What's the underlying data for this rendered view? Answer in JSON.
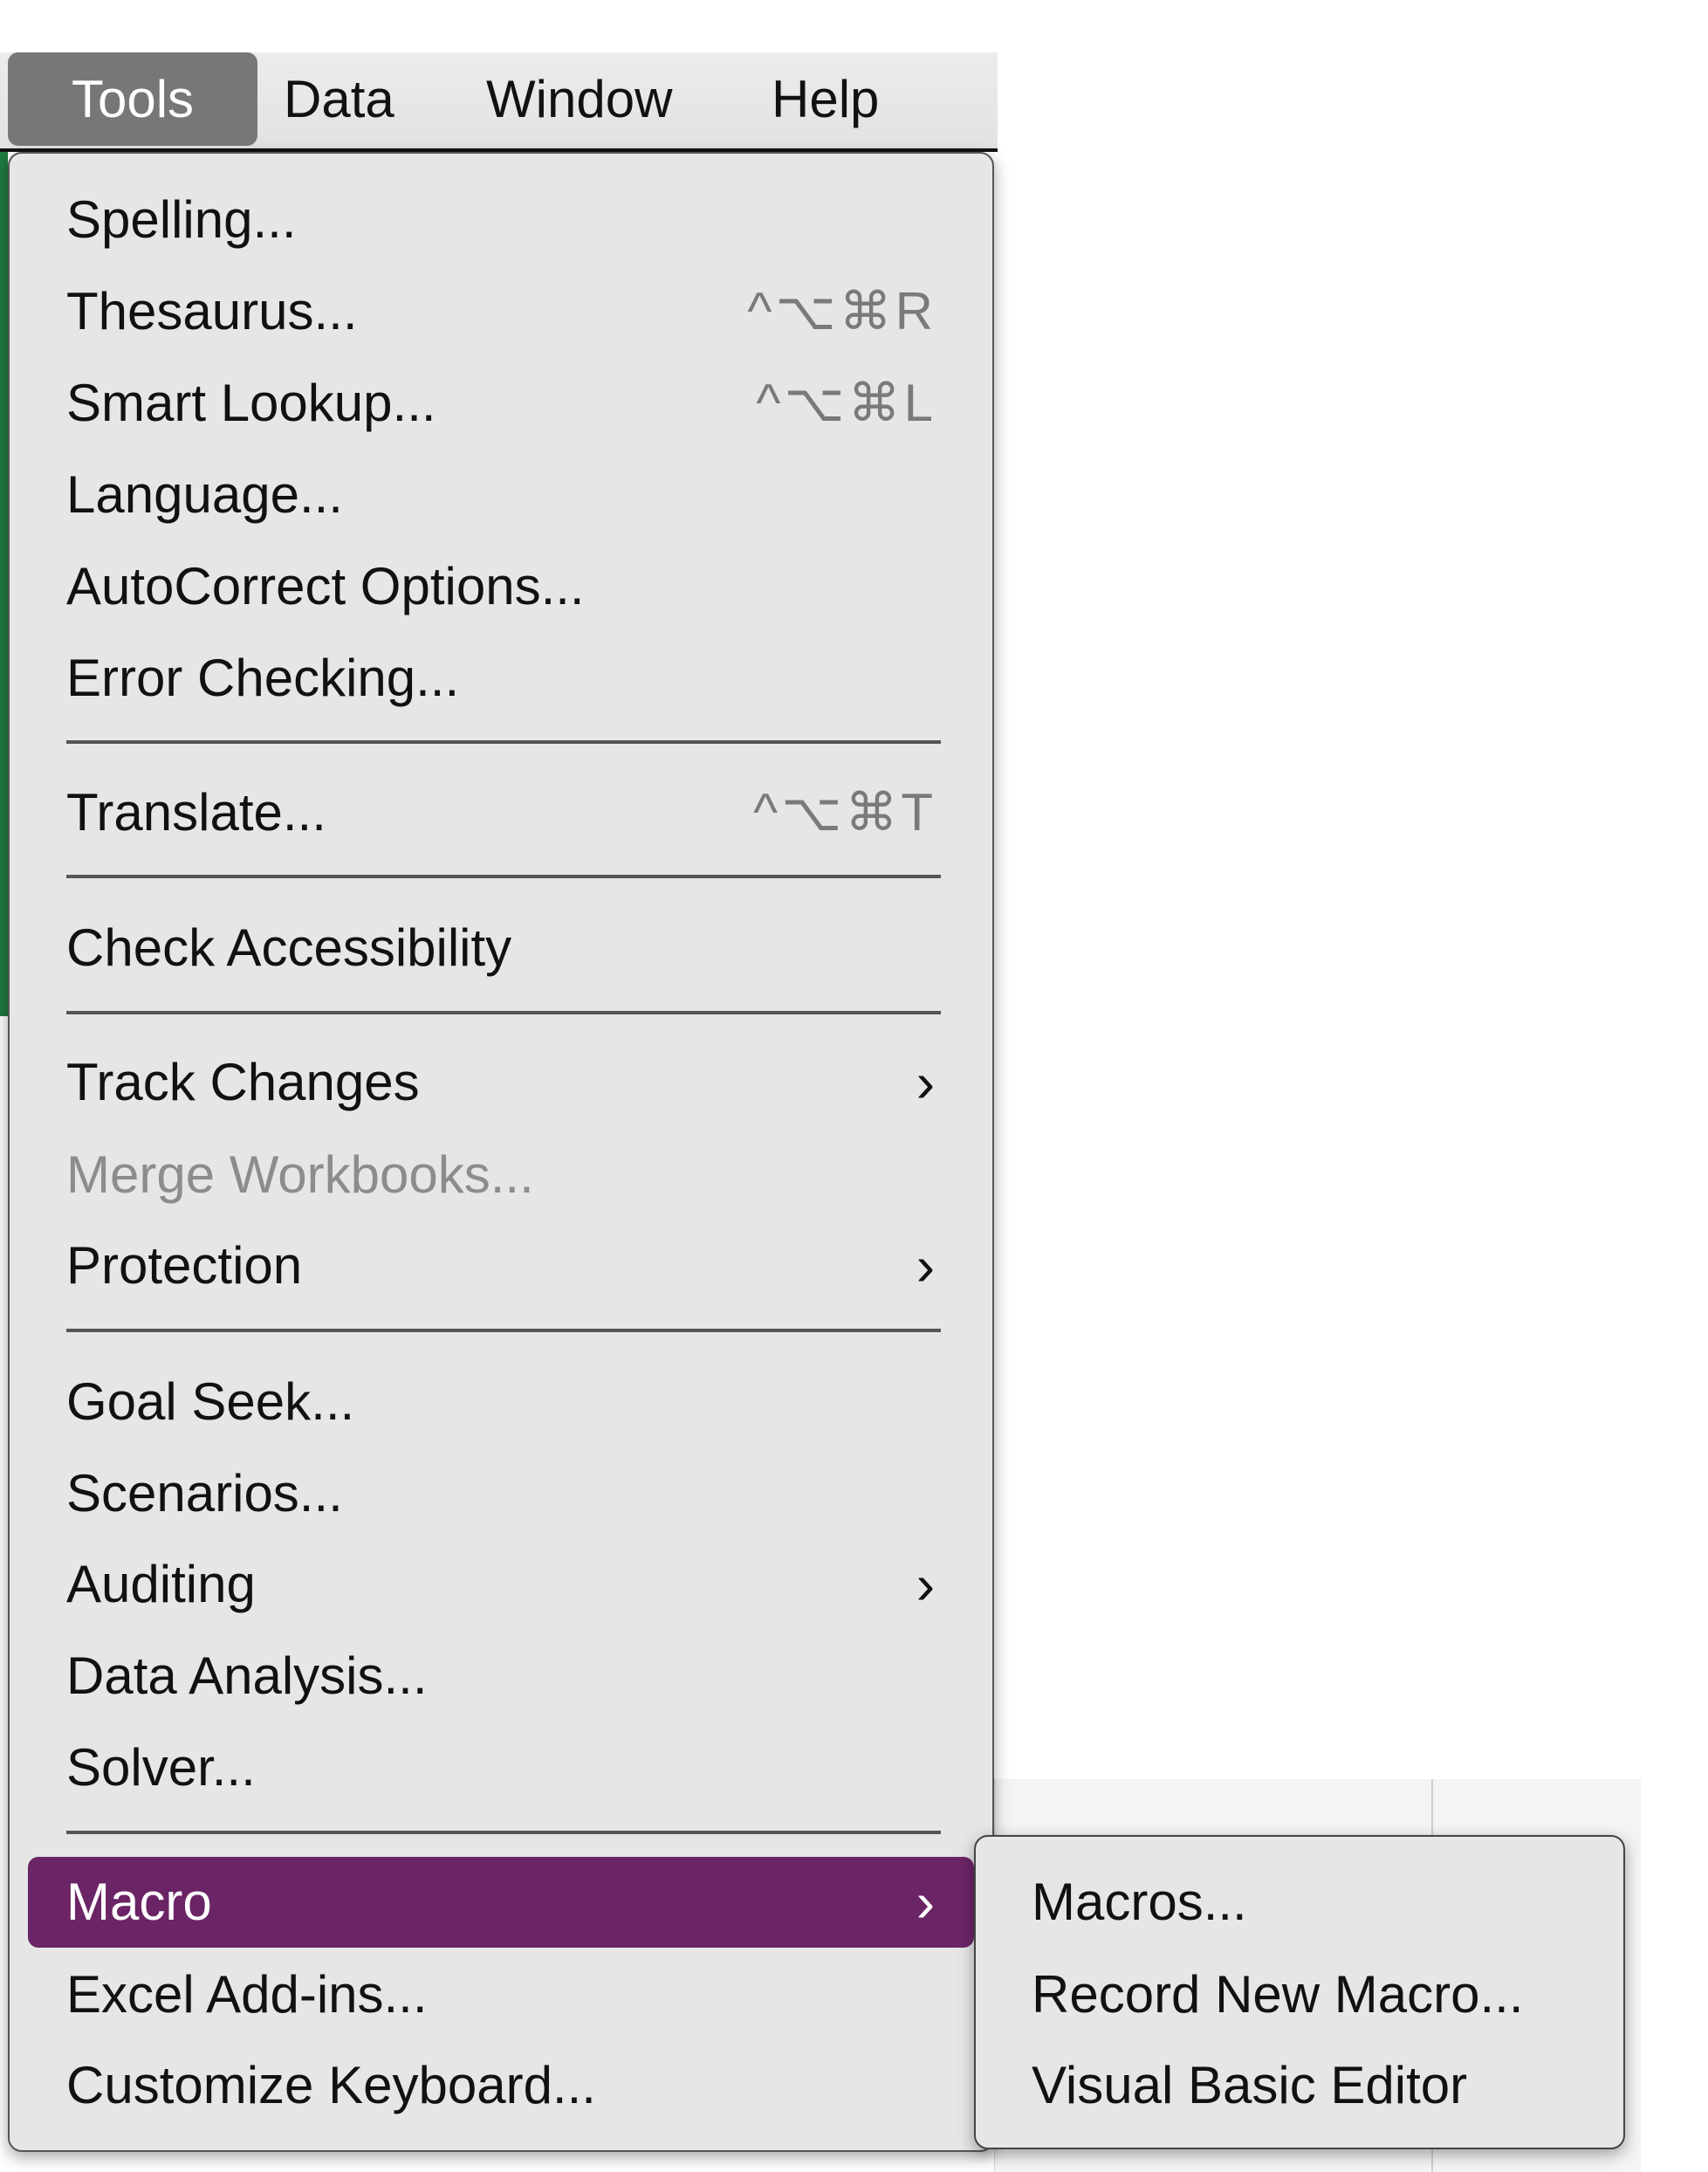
{
  "menubar": {
    "items": [
      {
        "label": "Tools",
        "active": true
      },
      {
        "label": "Data"
      },
      {
        "label": "Window"
      },
      {
        "label": "Help"
      }
    ]
  },
  "tools_menu": {
    "items": [
      {
        "label": "Spelling..."
      },
      {
        "label": "Thesaurus...",
        "shortcut": "^⌥⌘R"
      },
      {
        "label": "Smart Lookup...",
        "shortcut": "^⌥⌘L"
      },
      {
        "label": "Language..."
      },
      {
        "label": "AutoCorrect Options..."
      },
      {
        "label": "Error Checking..."
      },
      {
        "label": "Translate...",
        "shortcut": "^⌥⌘T"
      },
      {
        "label": "Check Accessibility"
      },
      {
        "label": "Track Changes",
        "submenu": true
      },
      {
        "label": "Merge Workbooks...",
        "disabled": true
      },
      {
        "label": "Protection",
        "submenu": true
      },
      {
        "label": "Goal Seek..."
      },
      {
        "label": "Scenarios..."
      },
      {
        "label": "Auditing",
        "submenu": true
      },
      {
        "label": "Data Analysis..."
      },
      {
        "label": "Solver..."
      },
      {
        "label": "Macro",
        "submenu": true,
        "highlighted": true
      },
      {
        "label": "Excel Add-ins..."
      },
      {
        "label": "Customize Keyboard..."
      }
    ],
    "chevron": "›"
  },
  "macro_submenu": {
    "items": [
      {
        "label": "Macros..."
      },
      {
        "label": "Record New Macro..."
      },
      {
        "label": "Visual Basic Editor"
      }
    ]
  },
  "colors": {
    "highlight": "#6b2466",
    "menu_bg": "#e6e6e6",
    "active_menubar": "#777777"
  }
}
